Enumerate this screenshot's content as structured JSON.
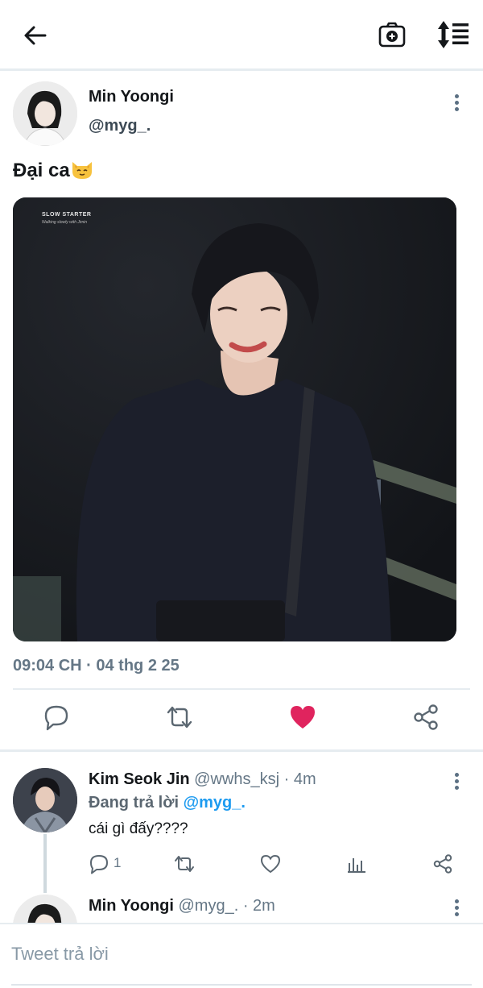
{
  "topbar": {
    "back_icon": "arrow-left-icon",
    "camera_icon": "camera-plus-icon",
    "sort_icon": "sort-order-icon"
  },
  "tweet": {
    "author_name": "Min Yoongi",
    "author_handle": "@myg_.",
    "text": "Đại ca",
    "emoji": "cat-face-emoji",
    "image_caption_title": "SLOW STARTER",
    "image_caption_sub": "Walking slowly with Jimin",
    "timestamp": "09:04 CH · 04 thg 2 25",
    "liked": true,
    "like_color": "#e0245e"
  },
  "replies": [
    {
      "name": "Kim Seok Jin",
      "handle": "@wwhs_ksj",
      "time": "· 4m",
      "replying_label": "Đang trả lời",
      "replying_to": "@myg_.",
      "body": "cái gì đấy????",
      "reply_count": "1"
    },
    {
      "name": "Min Yoongi",
      "handle": "@myg_.",
      "time": "· 2m"
    }
  ],
  "compose": {
    "placeholder": "Tweet trả lời"
  },
  "colors": {
    "accent": "#1d9bf0",
    "muted": "#657786",
    "like": "#e0245e"
  }
}
